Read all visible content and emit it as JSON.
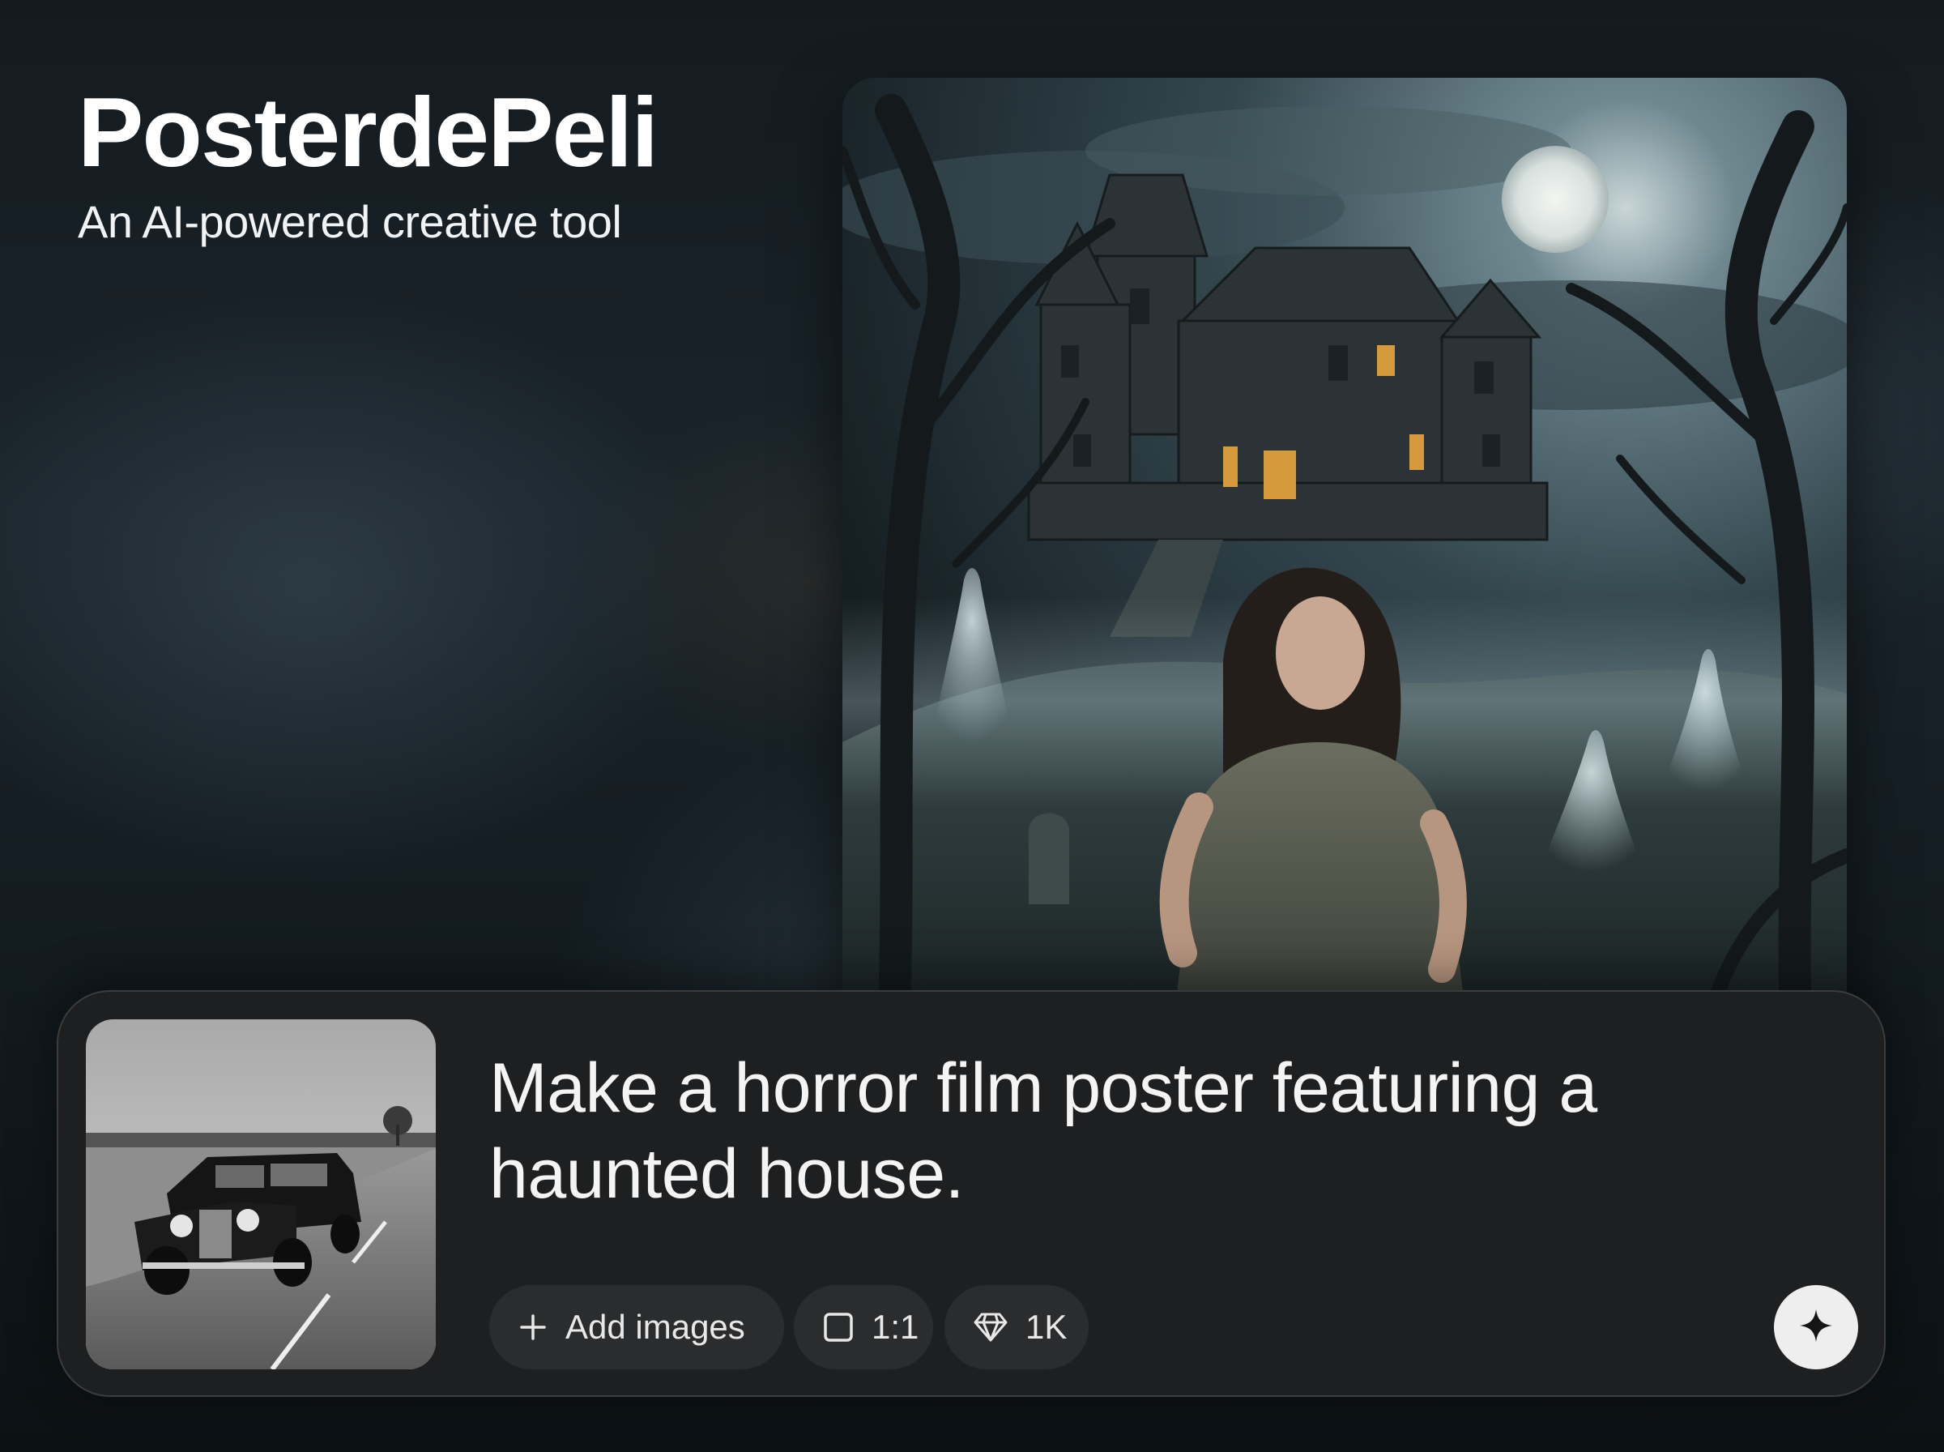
{
  "brand": {
    "title": "PosterdePeli",
    "subtitle": "An AI-powered creative tool"
  },
  "result": {
    "image_description": "Haunted Victorian mansion under a full moon, frightened woman in torn dress, ghostly figures among dead trees and gravestones"
  },
  "prompt": {
    "reference_image_description": "Black-and-white photo of a vintage 1930s car driving on a country road",
    "text": "Make a horror film poster featuring a haunted house.",
    "add_images_label": "Add images",
    "aspect_ratio": "1:1",
    "quality": "1K",
    "icons": {
      "add": "plus-icon",
      "ratio": "square-icon",
      "quality": "diamond-icon",
      "generate": "sparkle-icon"
    }
  },
  "colors": {
    "card_bg": "#1e1f20",
    "chip_bg": "#2b2c2d",
    "generate_button_bg": "#eeeeee",
    "text": "#ffffff"
  }
}
